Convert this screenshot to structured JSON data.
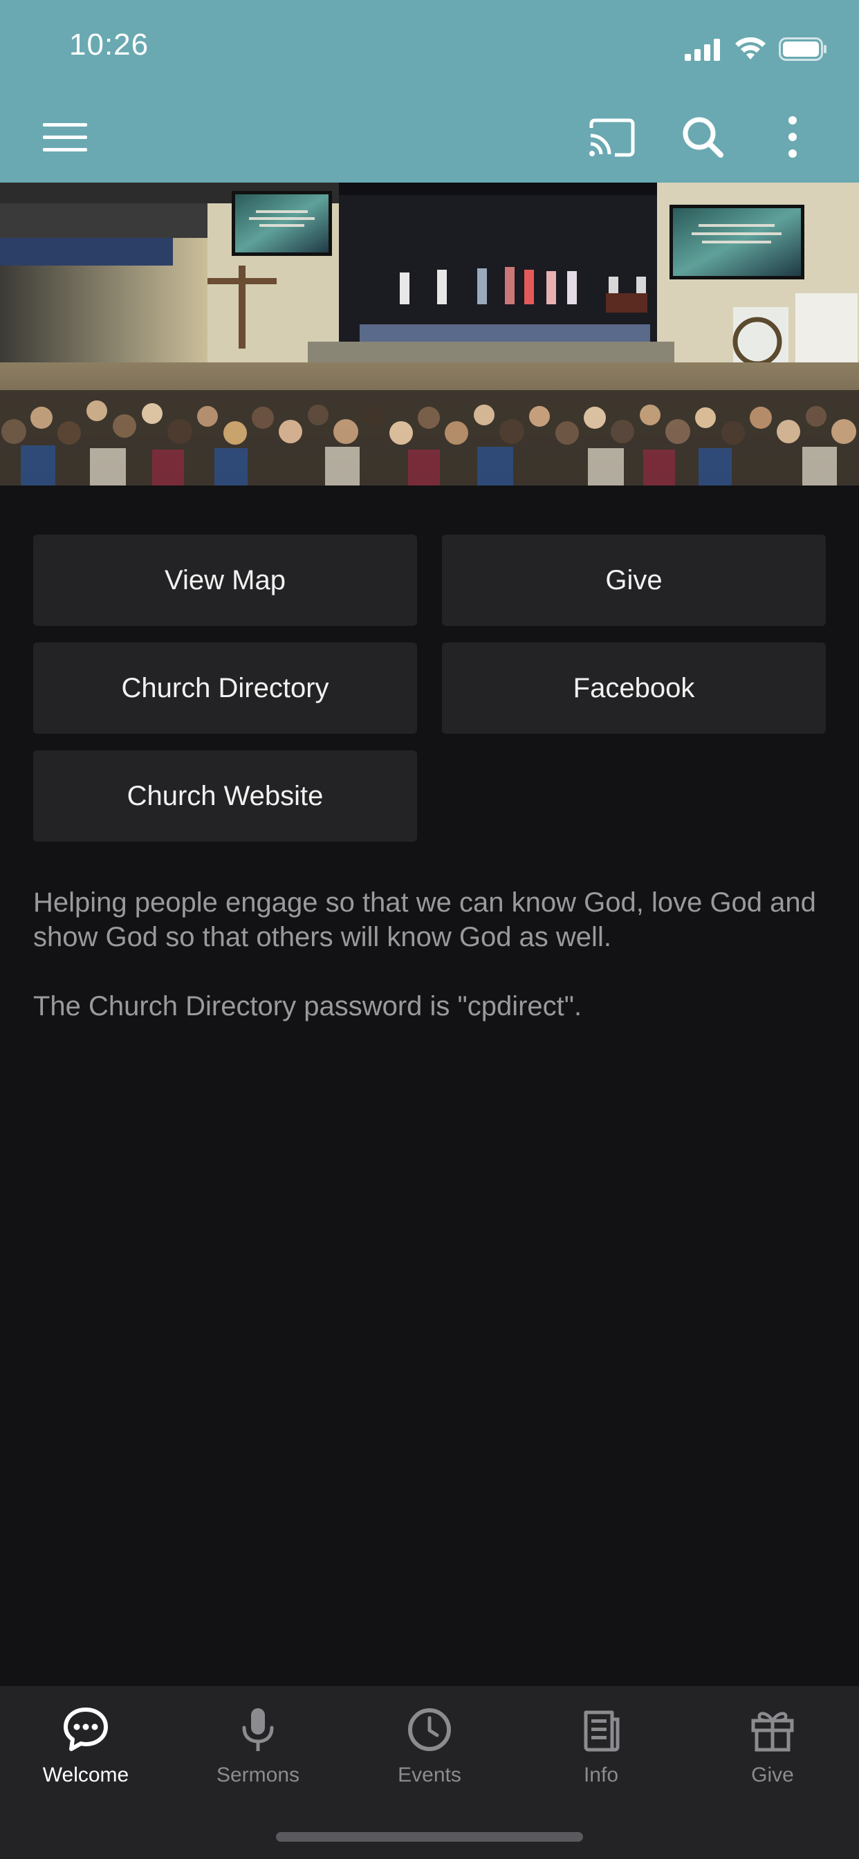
{
  "status_bar": {
    "time": "10:26"
  },
  "toolbar": {
    "menu_icon": "hamburger-menu-icon",
    "cast_icon": "cast-icon",
    "search_icon": "search-icon",
    "more_icon": "more-vertical-icon"
  },
  "hero": {
    "image": "church-worship-photo"
  },
  "buttons": [
    {
      "label": "View Map"
    },
    {
      "label": "Give"
    },
    {
      "label": "Church Directory"
    },
    {
      "label": "Facebook"
    },
    {
      "label": "Church Website"
    }
  ],
  "description": {
    "paragraph1": "Helping people engage so that we can know God, love God and show God so that others will know God as well.",
    "paragraph2": "The Church Directory password is \"cpdirect\"."
  },
  "tabs": [
    {
      "label": "Welcome",
      "icon": "chat-bubble-icon",
      "active": true
    },
    {
      "label": "Sermons",
      "icon": "microphone-icon",
      "active": false
    },
    {
      "label": "Events",
      "icon": "clock-icon",
      "active": false
    },
    {
      "label": "Info",
      "icon": "newspaper-icon",
      "active": false
    },
    {
      "label": "Give",
      "icon": "gift-icon",
      "active": false
    }
  ],
  "colors": {
    "header": "#6aa9b1",
    "background": "#121214",
    "button": "#232325",
    "tabbar": "#232325"
  }
}
